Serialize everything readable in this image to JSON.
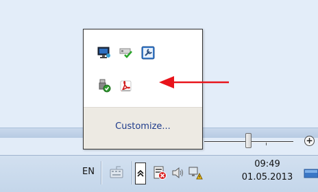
{
  "popup": {
    "customize_label": "Customize...",
    "icons": [
      "monitor-icon",
      "network-check-icon",
      "wrench-icon",
      "usb-safely-remove-icon",
      "adobe-reader-icon"
    ]
  },
  "taskbar": {
    "language": "EN",
    "clock": {
      "time": "09:49",
      "date": "01.05.2013"
    }
  },
  "annotation": {
    "arrow_color": "#e8141b"
  }
}
